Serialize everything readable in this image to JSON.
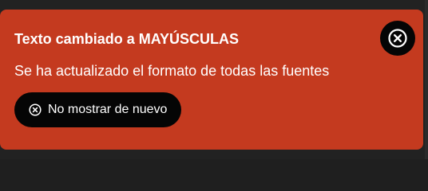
{
  "toast": {
    "title": "Texto cambiado a MAYÚSCULAS",
    "message": "Se ha actualizado el formato de todas las fuentes",
    "dismiss_label": "No mostrar de nuevo",
    "dismiss_icon": "circle-x-icon",
    "close_icon": "circle-x-icon"
  },
  "colors": {
    "toast_background": "#c43a1f",
    "button_background": "#050505",
    "text": "#ffffff",
    "backdrop": "#222222"
  }
}
